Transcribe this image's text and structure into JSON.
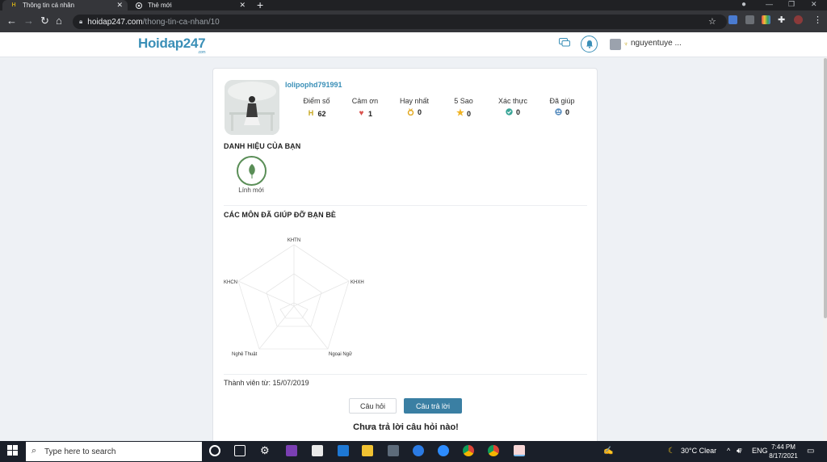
{
  "browser": {
    "tabs": [
      {
        "title": "Thông tin cá nhân",
        "favicon": "hoidap-favicon",
        "active": true
      },
      {
        "title": "Thẻ mới",
        "favicon": "chrome-icon",
        "active": false
      }
    ],
    "url_host": "hoidap247.com",
    "url_path": "/thong-tin-ca-nhan/10"
  },
  "site": {
    "logo": "Hoidap247",
    "logo_sub": ".com",
    "user_name": "nguyentuye ..."
  },
  "profile": {
    "username": "lolipophd791991",
    "stats": [
      {
        "label": "Điểm số",
        "value": "62",
        "icon": "points-icon"
      },
      {
        "label": "Cảm ơn",
        "value": "1",
        "icon": "heart-icon"
      },
      {
        "label": "Hay nhất",
        "value": "0",
        "icon": "medal-icon"
      },
      {
        "label": "5 Sao",
        "value": "0",
        "icon": "star-icon"
      },
      {
        "label": "Xác thực",
        "value": "0",
        "icon": "verified-icon"
      },
      {
        "label": "Đã giúp",
        "value": "0",
        "icon": "helped-icon"
      }
    ],
    "titles_heading": "DANH HIỆU CỦA BẠN",
    "badge_label": "Lính mới",
    "subjects_heading": "CÁC MÔN ĐÃ GIÚP ĐỠ BẠN BÈ",
    "radar_labels": [
      "KHTN",
      "KHXH",
      "Ngoại Ngữ",
      "Nghệ Thuật",
      "KHCN"
    ],
    "member_since": "Thành viên từ: 15/07/2019",
    "tab_questions": "Câu hỏi",
    "tab_answers": "Câu trả lời",
    "empty_message": "Chưa trả lời câu hỏi nào!"
  },
  "taskbar": {
    "search_placeholder": "Type here to search",
    "weather": "30°C  Clear",
    "language": "ENG",
    "time": "7:44 PM",
    "date": "8/17/2021"
  },
  "colors": {
    "brand": "#3a8fb7",
    "brand_gold": "#c6a51b",
    "answer_tab": "#3a7fa3",
    "badge_green": "#5a8e57"
  }
}
